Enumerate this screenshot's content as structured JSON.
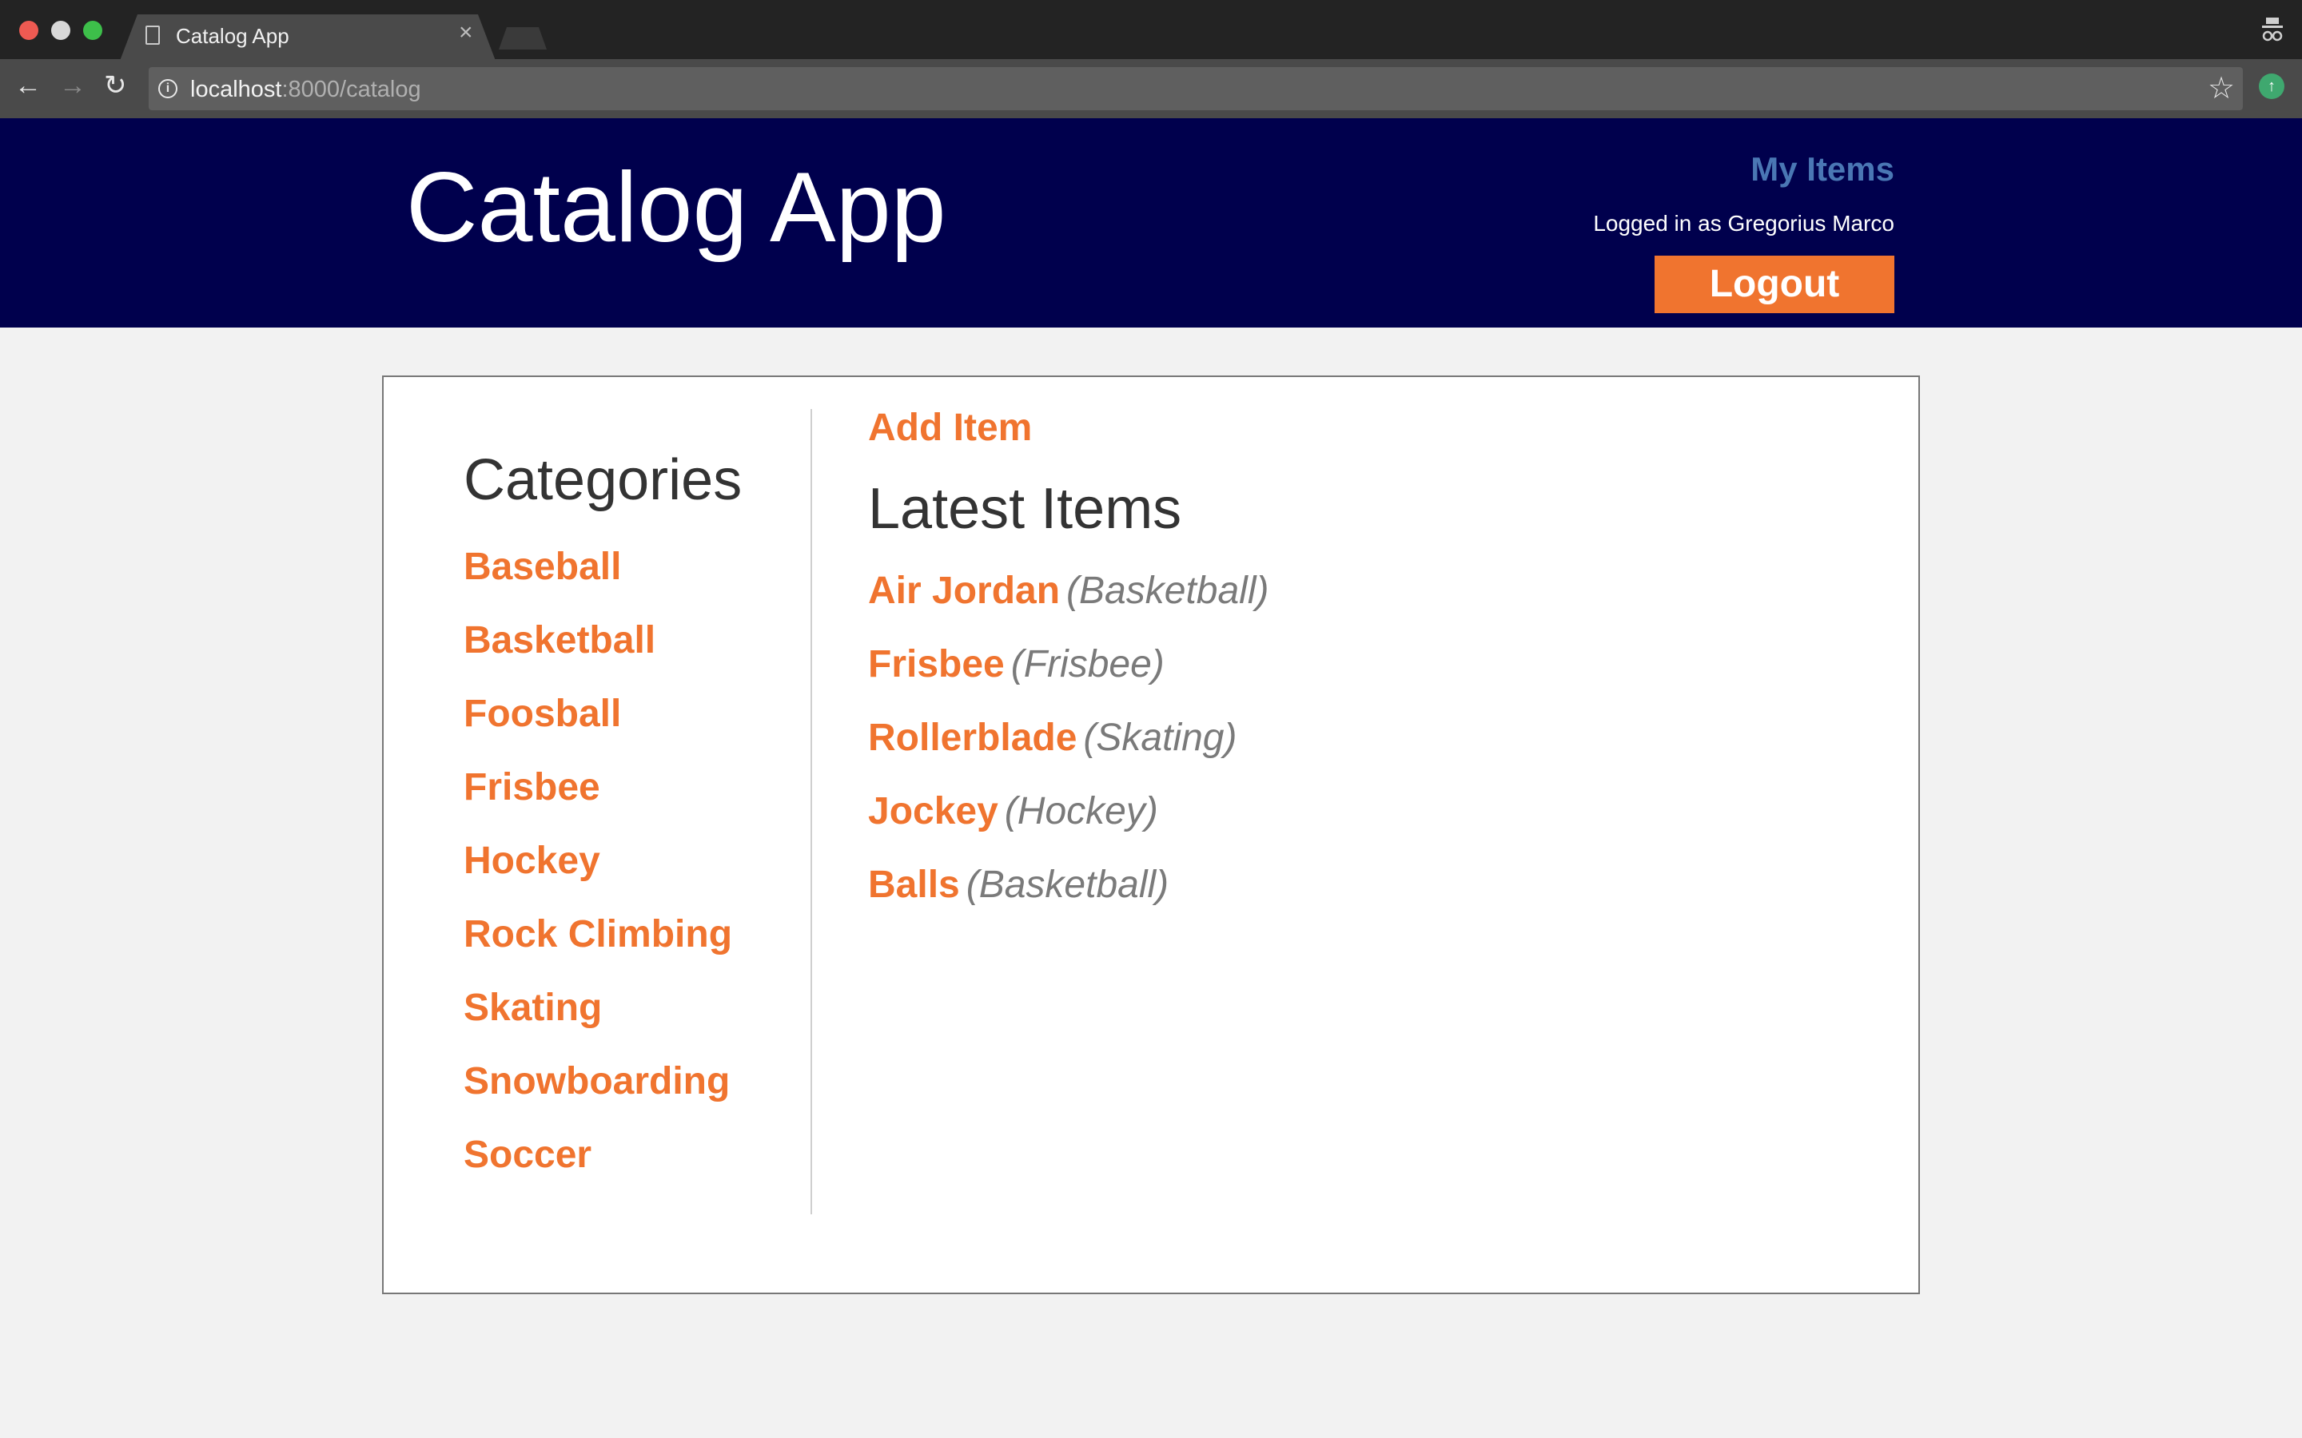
{
  "browser": {
    "tab_title": "Catalog App",
    "url_host": "localhost",
    "url_rest": ":8000/catalog"
  },
  "header": {
    "title": "Catalog App",
    "my_items_label": "My Items",
    "logged_in_text": "Logged in as Gregorius Marco",
    "logout_label": "Logout"
  },
  "sidebar": {
    "heading": "Categories",
    "items": [
      {
        "label": "Baseball"
      },
      {
        "label": "Basketball"
      },
      {
        "label": "Foosball"
      },
      {
        "label": "Frisbee"
      },
      {
        "label": "Hockey"
      },
      {
        "label": "Rock Climbing"
      },
      {
        "label": "Skating"
      },
      {
        "label": "Snowboarding"
      },
      {
        "label": "Soccer"
      }
    ]
  },
  "main": {
    "add_item_label": "Add Item",
    "heading": "Latest Items",
    "items": [
      {
        "name": "Air Jordan",
        "category": "(Basketball)"
      },
      {
        "name": "Frisbee",
        "category": "(Frisbee)"
      },
      {
        "name": "Rollerblade",
        "category": "(Skating)"
      },
      {
        "name": "Jockey",
        "category": "(Hockey)"
      },
      {
        "name": "Balls",
        "category": "(Basketball)"
      }
    ]
  },
  "colors": {
    "header_bg": "#00004d",
    "accent_orange": "#f0742f",
    "link_blue": "#4a77b4"
  }
}
